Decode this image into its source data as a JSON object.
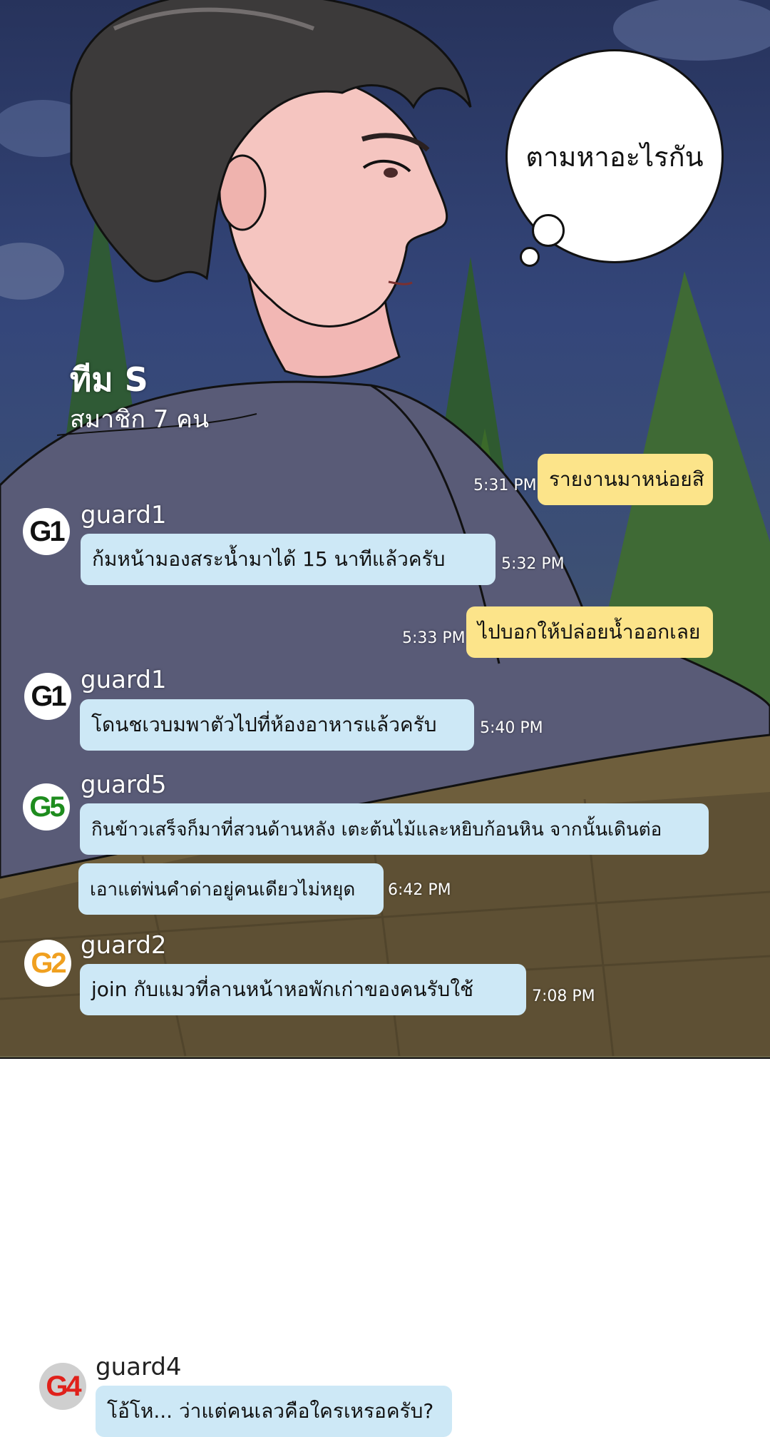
{
  "comic": {
    "thought_text": "ตามหาอะไรกัน"
  },
  "chat": {
    "group_name": "ทีม S",
    "member_count": "สมาชิก 7 คน",
    "colors": {
      "my_bubble": "#fce48a",
      "their_bubble": "#cde8f6"
    },
    "messages": [
      {
        "from": "me",
        "text": "รายงานมาหน่อยสิ",
        "time": "5:31 PM"
      },
      {
        "from": "guard1",
        "avatar": "G1",
        "avatar_color": "#111111",
        "text": "ก้มหน้ามองสระน้ำมาได้ 15 นาทีแล้วครับ",
        "time": "5:32 PM"
      },
      {
        "from": "me",
        "text": "ไปบอกให้ปล่อยน้ำออกเลย",
        "time": "5:33 PM"
      },
      {
        "from": "guard1",
        "avatar": "G1",
        "avatar_color": "#111111",
        "text": "โดนชเวบมพาตัวไปที่ห้องอาหารแล้วครับ",
        "time": "5:40 PM"
      },
      {
        "from": "guard5",
        "avatar": "G5",
        "avatar_color": "#1e8c1e",
        "text": "กินข้าวเสร็จก็มาที่สวนด้านหลัง เตะต้นไม้และหยิบก้อนหิน จากนั้นเดินต่อ",
        "text2": "เอาแต่พ่นคำด่าอยู่คนเดียวไม่หยุด",
        "time": "6:42 PM"
      },
      {
        "from": "guard2",
        "avatar": "G2",
        "avatar_color": "#f0a020",
        "text": "join กับแมวที่ลานหน้าหอพักเก่าของคนรับใช้",
        "time": "7:08 PM"
      },
      {
        "from": "guard4",
        "avatar": "G4",
        "avatar_color": "#e0201a",
        "text": "โอ้โห... ว่าแต่คนเลวคือใครเหรอครับ?"
      }
    ]
  }
}
